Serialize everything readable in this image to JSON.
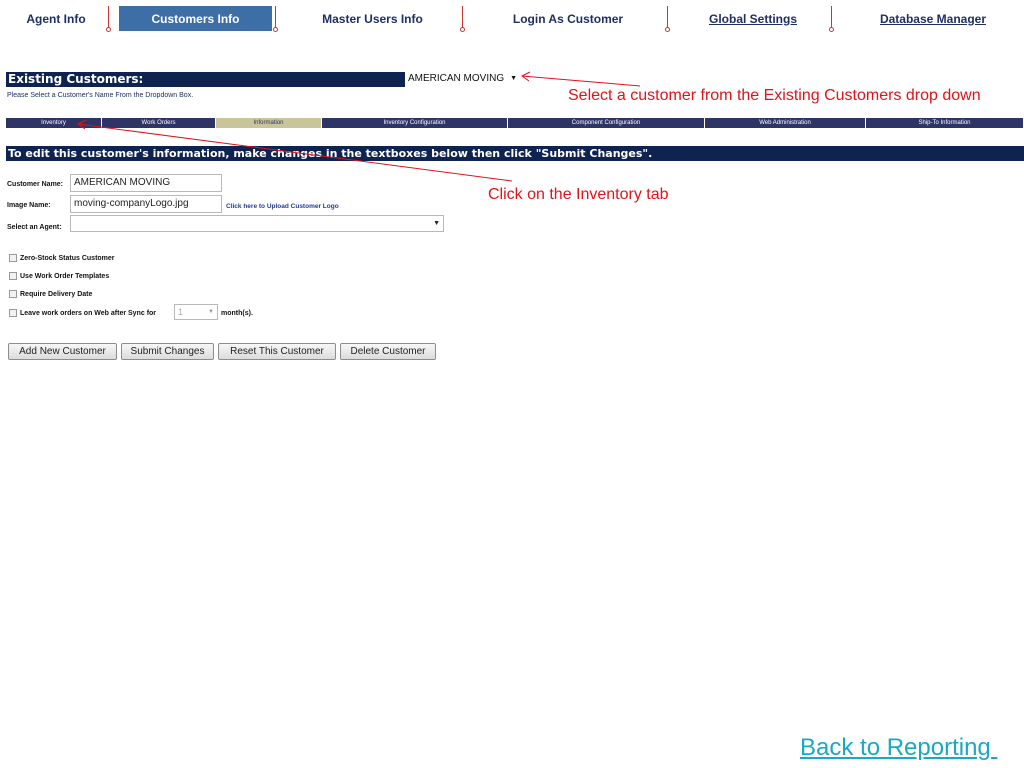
{
  "nav": {
    "items": [
      {
        "label": "Agent Info"
      },
      {
        "label": "Customers Info"
      },
      {
        "label": "Master Users Info"
      },
      {
        "label": "Login As Customer"
      },
      {
        "label": "Global Settings"
      },
      {
        "label": "Database Manager"
      }
    ],
    "active": "Customers Info"
  },
  "existing": {
    "header": "Existing Customers:",
    "selected": "AMERICAN MOVING",
    "help": "Please Select a Customer's Name From the Dropdown Box."
  },
  "annotations": {
    "select_customer": "Select a customer from the Existing Customers drop down",
    "inventory_tab": "Click on the Inventory tab"
  },
  "tabs": [
    {
      "label": "Inventory"
    },
    {
      "label": "Work Orders"
    },
    {
      "label": "Information"
    },
    {
      "label": "Inventory Configuration"
    },
    {
      "label": "Component Configuration"
    },
    {
      "label": "Web Administration"
    },
    {
      "label": "Ship-To Information"
    }
  ],
  "active_tab": "Information",
  "instruction": "To edit this customer's information, make changes in the textboxes below then click \"Submit Changes\".",
  "form": {
    "customer_name_label": "Customer Name:",
    "customer_name_value": "AMERICAN MOVING",
    "image_name_label": "Image Name:",
    "image_name_value": "moving-companyLogo.jpg",
    "upload_link": "Click here to Upload Customer Logo",
    "agent_label": "Select an Agent:",
    "agent_value": ""
  },
  "checkboxes": [
    {
      "label": "Zero-Stock Status Customer",
      "checked": false
    },
    {
      "label": "Use Work Order Templates",
      "checked": false
    },
    {
      "label": "Require Delivery Date",
      "checked": false
    },
    {
      "label": "Leave work orders on Web after Sync for",
      "checked": false
    }
  ],
  "months": {
    "value": "1",
    "suffix": "month(s)."
  },
  "buttons": {
    "add": "Add New Customer",
    "submit": "Submit Changes",
    "reset": "Reset This Customer",
    "delete": "Delete Customer"
  },
  "back_link": "Back to Reporting ",
  "colors": {
    "navy": "#0f2351",
    "active_nav": "#3e6ea6",
    "annotation": "#e0131a",
    "link": "#19a9c5",
    "active_tab": "#c9c59a"
  }
}
